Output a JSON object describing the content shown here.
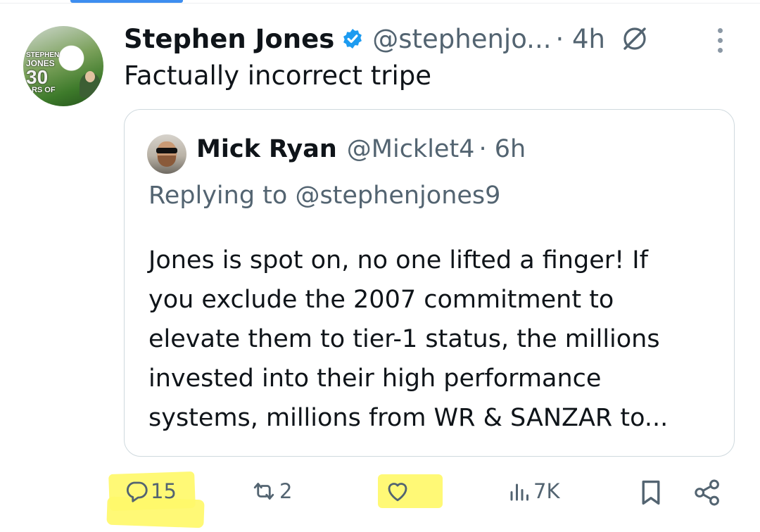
{
  "tweet": {
    "author_name": "Stephen Jones",
    "handle": "@stephenjo...",
    "time": "· 4h",
    "text": "Factually incorrect tripe",
    "avatar_text": [
      "STEPHEN",
      "JONES",
      "30",
      "ARS OF"
    ]
  },
  "quote": {
    "author_name": "Mick Ryan",
    "handle": "@Micklet4",
    "time": "· 6h",
    "replying_to": "Replying to @stephenjones9",
    "body_lines": [
      "Jones is spot on, no one lifted a finger! If",
      "you exclude the 2007 commitment to",
      "elevate them to tier-1 status, the millions",
      "invested into their high performance",
      "systems, millions from WR & SANZAR to..."
    ]
  },
  "actions": {
    "replies": "15",
    "reposts": "2",
    "likes": "",
    "views": "7K"
  },
  "colors": {
    "text": "#0f1419",
    "secondary": "#536471",
    "verified": "#1d9bf0",
    "border": "#cfd9de",
    "highlight": "#fff86a"
  },
  "icons": [
    "verified-badge-icon",
    "grok-icon",
    "more-options-icon",
    "reply-icon",
    "repost-icon",
    "like-icon",
    "views-icon",
    "bookmark-icon",
    "share-icon"
  ]
}
